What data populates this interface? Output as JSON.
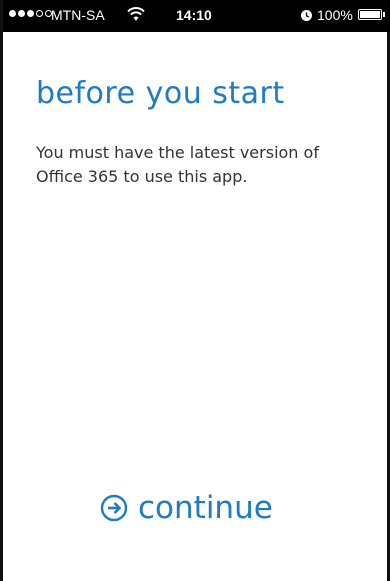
{
  "status_bar": {
    "carrier": "MTN-SA",
    "time": "14:10",
    "battery": "100%",
    "signal_strength": 3,
    "signal_max": 5,
    "icons": [
      "wifi-icon",
      "alarm-icon",
      "battery-icon"
    ]
  },
  "screen": {
    "title": "before you start",
    "message": "You must have the latest version of Office 365 to use this app.",
    "continue_label": "continue",
    "continue_icon": "arrow-circle-right-icon"
  },
  "colors": {
    "accent": "#1e7bc4",
    "text": "#333333",
    "status_bar_bg": "#000000",
    "background": "#ffffff"
  }
}
